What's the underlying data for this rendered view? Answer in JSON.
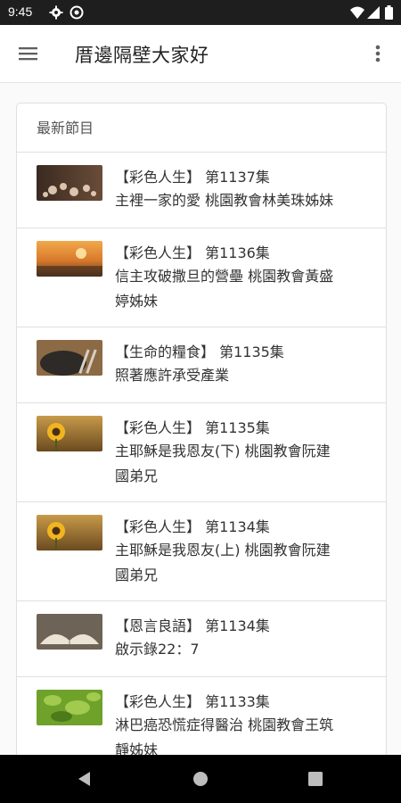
{
  "status_bar": {
    "time": "9:45",
    "icons": [
      "gear-icon",
      "at-sign-icon",
      "wifi-icon",
      "signal-icon",
      "battery-icon"
    ]
  },
  "app_bar": {
    "title": "厝邊隔壁大家好",
    "icons": [
      "hamburger-menu-icon",
      "more-vert-icon"
    ]
  },
  "section": {
    "header": "最新節目"
  },
  "episodes": [
    {
      "title": "【彩色人生】 第1137集",
      "desc": "主裡一家的愛 桃園教會林美珠姊妹",
      "thumb": "hearts-bokeh"
    },
    {
      "title": "【彩色人生】 第1136集",
      "desc": "信主攻破撒旦的營壘 桃園教會黃盛\n婷姊妹",
      "thumb": "sunset-field"
    },
    {
      "title": "【生命的糧食】 第1135集",
      "desc": "照著應許承受產業",
      "thumb": "fork-plate"
    },
    {
      "title": "【彩色人生】 第1135集",
      "desc": "主耶穌是我恩友(下) 桃園教會阮建\n國弟兄",
      "thumb": "sunflower"
    },
    {
      "title": "【彩色人生】 第1134集",
      "desc": "主耶穌是我恩友(上) 桃園教會阮建\n國弟兄",
      "thumb": "sunflower"
    },
    {
      "title": "【恩言良語】 第1134集",
      "desc": "啟示錄22：7",
      "thumb": "open-book"
    },
    {
      "title": "【彩色人生】 第1133集",
      "desc": "淋巴癌恐慌症得醫治 桃園教會王筑\n靜姊妹",
      "thumb": "green-leaves"
    }
  ],
  "nav_bar": {
    "icons": [
      "back-icon",
      "home-icon",
      "recents-icon"
    ]
  }
}
